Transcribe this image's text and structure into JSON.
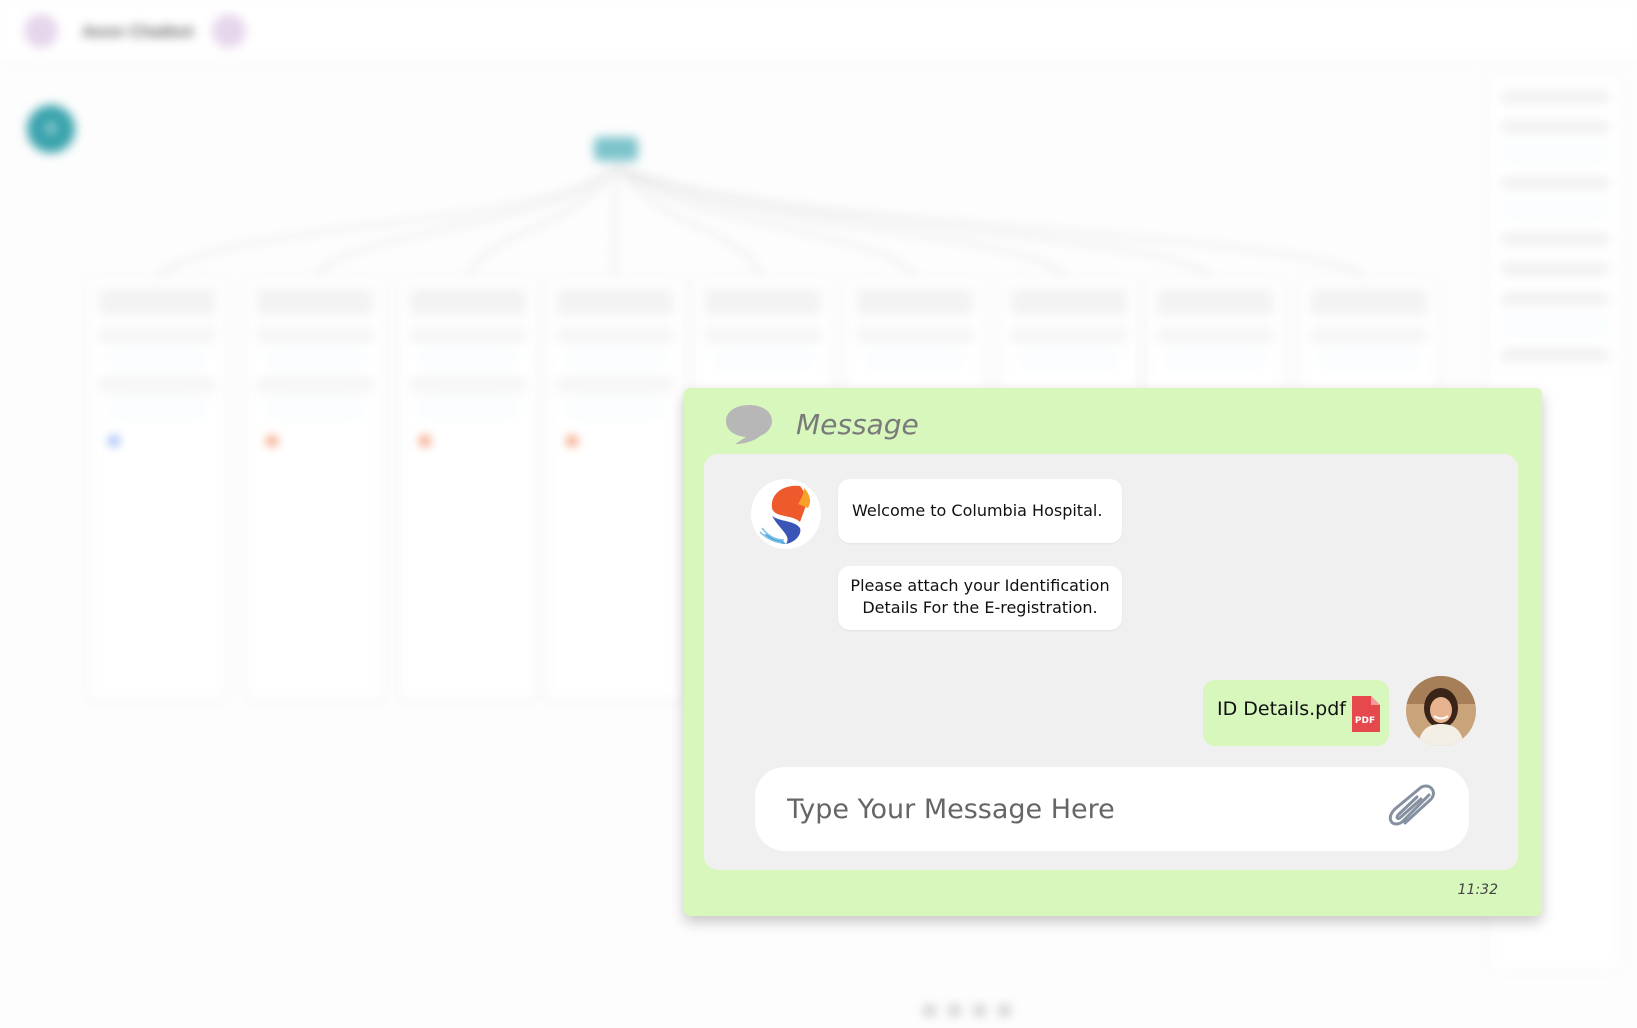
{
  "background": {
    "app_title": "Aeon Chatbot"
  },
  "chat": {
    "title": "Message",
    "bot_messages": [
      {
        "text": "Welcome to Columbia Hospital."
      },
      {
        "line1": "Please attach your Identification",
        "line2": "Details For the E-registration."
      }
    ],
    "user_attachment": {
      "file_name": "ID Details.pdf",
      "badge": "PDF"
    },
    "input": {
      "placeholder": "Type Your Message Here",
      "value": ""
    },
    "timestamp": "11:32",
    "colors": {
      "window": "#d7f7bd",
      "body": "#f0f0f0",
      "bubble": "#ffffff",
      "pdf": "#e5484d"
    },
    "icons": [
      "chat-bubble-icon",
      "hospital-logo",
      "pdf-file-icon",
      "paperclip-icon"
    ]
  }
}
